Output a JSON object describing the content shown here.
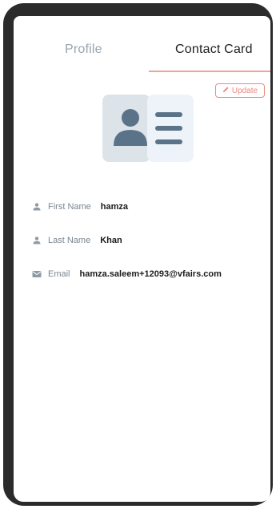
{
  "tabs": [
    {
      "label": "Profile",
      "active": false
    },
    {
      "label": "Contact Card",
      "active": true
    }
  ],
  "update_button": {
    "label": "Update",
    "icon": "pencil-icon"
  },
  "illustration": {
    "icon": "contact-card-icon"
  },
  "fields": [
    {
      "icon": "person-icon",
      "label": "First Name",
      "value": "hamza"
    },
    {
      "icon": "person-icon",
      "label": "Last Name",
      "value": "Khan"
    },
    {
      "icon": "mail-icon",
      "label": "Email",
      "value": "hamza.saleem+12093@vfairs.com"
    }
  ],
  "colors": {
    "accent": "#e98a80",
    "tab_underline": "#f0a39a",
    "inactive_tab": "#9aa4ad",
    "label": "#7a8690",
    "frame": "#2b2b2b"
  }
}
